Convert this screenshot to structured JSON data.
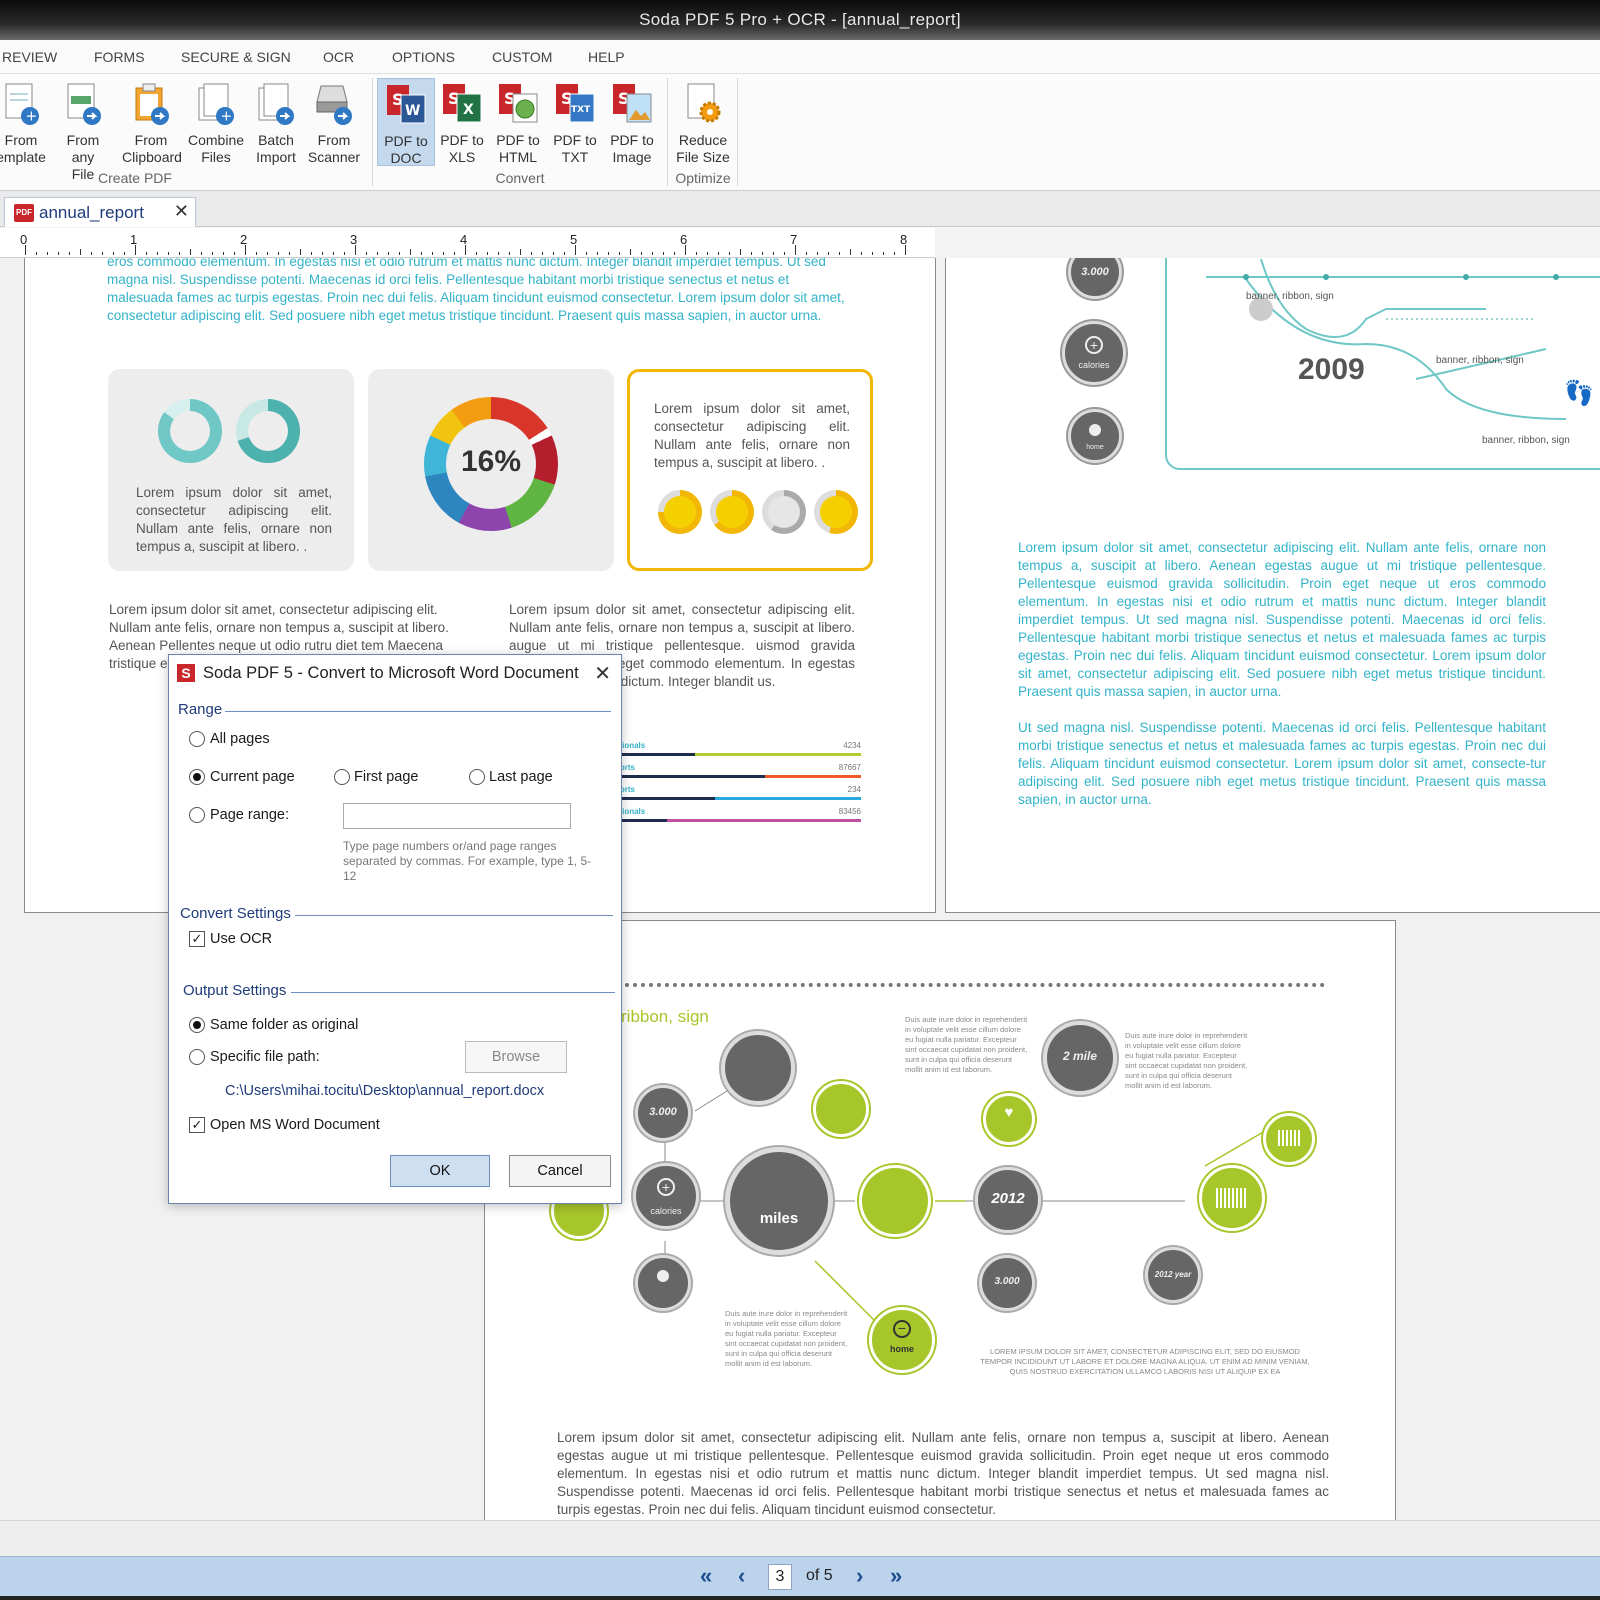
{
  "window": {
    "title": "Soda PDF 5 Pro + OCR - [annual_report]"
  },
  "menu": [
    "REVIEW",
    "FORMS",
    "SECURE & SIGN",
    "OCR",
    "OPTIONS",
    "CUSTOM",
    "HELP"
  ],
  "ribbon": {
    "create_pdf": {
      "label": "Create PDF",
      "buttons": [
        "From\nemplate",
        "From any\nFile",
        "From\nClipboard",
        "Combine\nFiles",
        "Batch\nImport",
        "From\nScanner"
      ]
    },
    "convert": {
      "label": "Convert",
      "buttons": [
        "PDF to\nDOC",
        "PDF to\nXLS",
        "PDF to\nHTML",
        "PDF to\nTXT",
        "PDF to\nImage"
      ]
    },
    "optimize": {
      "label": "Optimize",
      "buttons": [
        "Reduce\nFile Size"
      ]
    },
    "colors": {
      "accent_active": "#c5d9ee",
      "pdf_red": "#c8262b"
    }
  },
  "tab": {
    "name": "annual_report",
    "icon": "pdf-file-icon"
  },
  "ruler": [
    "0",
    "1",
    "2",
    "3",
    "4",
    "5",
    "6",
    "7",
    "8"
  ],
  "document": {
    "p1_top": "eros commodo elementum. In egestas nisi et odio rutrum et mattis nunc dictum. Integer blandit imperdiet tempus. Ut sed magna nisl. Suspendisse potenti. Maecenas id orci felis. Pellentesque habitant morbi tristique senectus et netus et malesuada fames ac turpis egestas. Proin nec dui felis. Aliquam tincidunt euismod consectetur. Lorem ipsum dolor sit amet, consectetur adipiscing elit. Sed posuere nibh eget metus tristique tincidunt. Praesent quis massa sapien, in auctor urna.",
    "card1": "Lorem ipsum dolor sit amet, consectetur adipiscing elit. Nullam ante felis, ornare non tempus a, suscipit at libero. .",
    "card2_percent": "16%",
    "card3": "Lorem ipsum dolor sit amet, consectetur adipiscing elit. Nullam ante felis, ornare non tempus a, suscipit at libero. .",
    "col_left": "Lorem ipsum dolor sit amet, consectetur adipiscing elit. Nullam ante felis, ornare non tempus a, suscipit at libero. Aenean Pellentes neque ut odio rutru diet tem Maecena tristique egestas. consecte adipiscin tincidunt",
    "col_right": "Lorem ipsum dolor sit amet, consectetur adipiscing elit. Nullam ante felis, ornare non tempus a, suscipit at libero. augue ut mi tristique pellentesque. uismod gravida sollicitudin. Proin eget commodo elementum. In egestas nisi et mattis nunc dictum. Integer blandit us.",
    "bars": [
      {
        "label": "ationals",
        "value": "4234"
      },
      {
        "label": "ports",
        "value": "87667"
      },
      {
        "label": "ports",
        "value": "234"
      },
      {
        "label": "ationals",
        "value": "83456"
      }
    ],
    "p2_timeline": {
      "year": "2009",
      "labels": [
        "banner, ribbon, sign",
        "banner, ribbon, sign",
        "banner, ribbon, sign"
      ],
      "circles": [
        "3.000",
        "calories",
        "home"
      ]
    },
    "p2_text1": "Lorem ipsum dolor sit amet, consectetur adipiscing elit. Nullam ante felis, ornare non tempus a, suscipit at libero. Aenean egestas augue ut mi tristique pellentesque. Pellentesque euismod gravida sollicitudin. Proin eget neque ut eros commodo elementum. In egestas nisi et odio rutrum et mattis nunc dictum. Integer blandit imperdiet tempus. Ut sed magna nisl. Suspendisse potenti. Maecenas id orci felis. Pellentesque habitant morbi tristique senectus et netus et malesuada fames ac turpis egestas. Proin nec dui felis. Aliquam tincidunt euismod consectetur. Lorem ipsum dolor sit amet, consectetur adipiscing elit. Sed posuere nibh eget metus tristique tincidunt. Praesent quis massa sapien, in auctor urna.",
    "p2_text2": "Ut sed magna nisl. Suspendisse potenti. Maecenas id orci felis. Pellentesque habitant morbi tristique senectus et netus et malesuada fames ac turpis egestas. Proin nec dui felis. Aliquam tincidunt euismod consectetur. Lorem ipsum dolor sit amet, consecte-tur adipiscing elit. Sed posuere nibh eget metus tristique tincidunt. Praesent quis massa sapien, in auctor urna.",
    "p3_heading": "ribbon, sign",
    "p3_circles": [
      "3.000",
      "calories",
      "miles",
      "home",
      "2012",
      "3.000",
      "2 mile",
      "heart",
      "2012 year",
      "home"
    ],
    "p3_small": "Duis aute irure dolor in reprehenderit in voluptate velit esse cillum dolore eu fugiat nulla pariatur. Excepteur sint occaecat cupidatat non proident, sunt in culpa qui officia deserunt mollit anim id est laborum.",
    "p3_caps": "LOREM IPSUM DOLOR SIT AMET, CONSECTETUR ADIPISCING ELIT, SED DO EIUSMOD TEMPOR INCIDIDUNT UT LABORE ET DOLORE MAGNA ALIQUA. UT ENIM AD MINIM VENIAM, QUIS NOSTRUD EXERCITATION ULLAMCO LABORIS NISI UT ALIQUIP EX EA",
    "p3_bottom": "Lorem ipsum dolor sit amet, consectetur adipiscing elit. Nullam ante felis, ornare non tempus a, suscipit at libero. Aenean egestas augue ut mi tristique pellentesque. Pellentesque euismod gravida sollicitudin. Proin eget neque ut eros commodo elementum. In egestas nisi et odio rutrum et mattis nunc dictum. Integer blandit imperdiet tempus. Ut sed magna nisl. Suspendisse potenti. Maecenas id orci felis. Pellentesque habitant morbi tristique senectus et netus et malesuada fames ac turpis egestas. Proin nec dui felis. Aliquam tincidunt euismod consectetur.",
    "colors": {
      "teal": "#33b3c9",
      "lime": "#a7c62a",
      "yellow": "#f2b705"
    }
  },
  "dialog": {
    "title": "Soda PDF 5 - Convert to Microsoft Word Document",
    "range": {
      "label": "Range",
      "all_pages": "All pages",
      "current_page": "Current page",
      "first_page": "First page",
      "last_page": "Last page",
      "page_range": "Page range:",
      "page_range_value": "",
      "hint": "Type page numbers or/and page ranges separated by commas. For example, type 1, 5-12",
      "selected": "current_page"
    },
    "convert_settings": {
      "label": "Convert Settings",
      "use_ocr": "Use OCR",
      "use_ocr_checked": true
    },
    "output_settings": {
      "label": "Output Settings",
      "same_folder": "Same folder as original",
      "specific_path": "Specific file path:",
      "browse": "Browse",
      "path": "C:\\Users\\mihai.tocitu\\Desktop\\annual_report.docx",
      "open_word": "Open MS Word Document",
      "open_word_checked": true,
      "selected": "same_folder"
    },
    "ok": "OK",
    "cancel": "Cancel"
  },
  "nav": {
    "current_page": "3",
    "of_label": "of 5"
  }
}
